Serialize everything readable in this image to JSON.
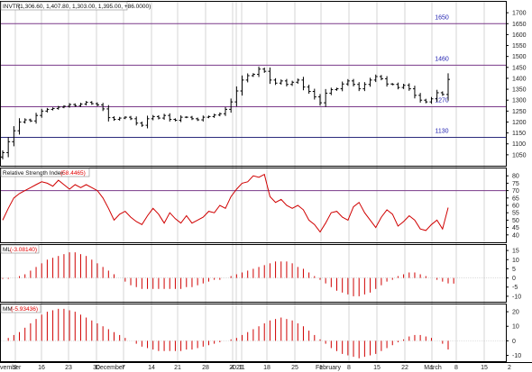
{
  "chart_data": [
    {
      "type": "ohlc",
      "panel": "price",
      "symbol": "INVTR",
      "header_values": "(1,306.60, 1,407.80, 1,303.00, 1,395.00, +86.0000)",
      "ylim": [
        1000,
        1750
      ],
      "yticks": [
        "1700",
        "1650",
        "1600",
        "1550",
        "1500",
        "1450",
        "1400",
        "1350",
        "1300",
        "1250",
        "1200",
        "1150",
        "1100",
        "1050"
      ],
      "ytick_values": [
        1700,
        1650,
        1600,
        1550,
        1500,
        1450,
        1400,
        1350,
        1300,
        1250,
        1200,
        1150,
        1100,
        1050
      ],
      "levels": [
        {
          "value": 1650,
          "label": "1650"
        },
        {
          "value": 1460,
          "label": "1460"
        },
        {
          "value": 1270,
          "label": "1270"
        },
        {
          "value": 1130,
          "label": "1130"
        }
      ],
      "close": [
        1060,
        1110,
        1160,
        1200,
        1210,
        1205,
        1230,
        1250,
        1258,
        1262,
        1268,
        1272,
        1280,
        1275,
        1282,
        1290,
        1284,
        1278,
        1260,
        1220,
        1212,
        1218,
        1222,
        1215,
        1195,
        1185,
        1215,
        1225,
        1218,
        1230,
        1212,
        1208,
        1222,
        1222,
        1215,
        1210,
        1222,
        1225,
        1232,
        1238,
        1258,
        1292,
        1342,
        1392,
        1412,
        1418,
        1442,
        1432,
        1392,
        1378,
        1388,
        1372,
        1382,
        1392,
        1360,
        1340,
        1315,
        1288,
        1332,
        1348,
        1352,
        1374,
        1388,
        1372,
        1352,
        1372,
        1392,
        1408,
        1398,
        1374,
        1372,
        1358,
        1368,
        1352,
        1322,
        1300,
        1292,
        1306,
        1334,
        1326,
        1395
      ]
    },
    {
      "type": "line",
      "panel": "rsi",
      "title": "Relative Strength Index",
      "value_label": "(58.4465)",
      "ylim": [
        35,
        85
      ],
      "yticks": [
        "80",
        "75",
        "70",
        "65",
        "60",
        "55",
        "50",
        "45",
        "40"
      ],
      "ytick_values": [
        80,
        75,
        70,
        65,
        60,
        55,
        50,
        45,
        40
      ],
      "hline": 70,
      "values": [
        50,
        58,
        65,
        68,
        70,
        72,
        74,
        76,
        75,
        73,
        77,
        74,
        71,
        74,
        72,
        74,
        72,
        70,
        65,
        58,
        50,
        54,
        56,
        52,
        49,
        47,
        53,
        58,
        54,
        48,
        55,
        51,
        48,
        53,
        48,
        50,
        52,
        56,
        55,
        60,
        58,
        66,
        71,
        75,
        76,
        80,
        79,
        81,
        66,
        62,
        64,
        60,
        58,
        60,
        57,
        50,
        47,
        42,
        48,
        55,
        56,
        52,
        50,
        59,
        62,
        55,
        50,
        45,
        52,
        57,
        54,
        46,
        49,
        53,
        50,
        44,
        43,
        47,
        50,
        44,
        58.4465
      ]
    },
    {
      "type": "histogram",
      "panel": "ml",
      "title": "ML",
      "value_label": "(-3.08140)",
      "ylim": [
        -13,
        18
      ],
      "yticks": [
        "15",
        "10",
        "5",
        "0",
        "-5",
        "-10"
      ],
      "ytick_values": [
        15,
        10,
        5,
        0,
        -5,
        -10
      ],
      "values": [
        -0.5,
        -0.5,
        0,
        1,
        2,
        4,
        6,
        8,
        10,
        11,
        12,
        13,
        14,
        14,
        13,
        12,
        10,
        8,
        6,
        4,
        2,
        0,
        -2,
        -4,
        -5,
        -6,
        -6,
        -6,
        -6,
        -6,
        -6,
        -6,
        -6,
        -5,
        -5,
        -4,
        -3,
        -2,
        -1,
        -1,
        0,
        1,
        2,
        3,
        4,
        5,
        6,
        7,
        8,
        9,
        9,
        9,
        8,
        6,
        5,
        3,
        1,
        -1,
        -3,
        -5,
        -7,
        -8,
        -9,
        -10,
        -10,
        -9,
        -8,
        -6,
        -4,
        -2,
        -1,
        1,
        2,
        3,
        3,
        2,
        1,
        0,
        -1,
        -2,
        -3,
        -3.0814
      ]
    },
    {
      "type": "histogram",
      "panel": "mm",
      "title": "MM",
      "value_label": "(-5.93436)",
      "ylim": [
        -14,
        25
      ],
      "yticks": [
        "20",
        "10",
        "0",
        "-10"
      ],
      "ytick_values": [
        20,
        10,
        0,
        -10
      ],
      "values": [
        0,
        2,
        4,
        6,
        9,
        12,
        15,
        18,
        20,
        21,
        22,
        22,
        21,
        20,
        18,
        16,
        14,
        12,
        10,
        8,
        6,
        4,
        2,
        0,
        -2,
        -4,
        -5,
        -6,
        -7,
        -7,
        -7,
        -7,
        -7,
        -6,
        -6,
        -5,
        -4,
        -3,
        -2,
        -1,
        0,
        1,
        2,
        4,
        6,
        8,
        10,
        12,
        14,
        15,
        16,
        15,
        14,
        12,
        10,
        7,
        4,
        1,
        -2,
        -5,
        -7,
        -9,
        -10,
        -11,
        -12,
        -11,
        -10,
        -9,
        -7,
        -5,
        -3,
        -1,
        1,
        3,
        4,
        4,
        3,
        2,
        0,
        -2,
        -5.93436
      ]
    }
  ],
  "x_axis": {
    "labels": [
      "vember",
      "9",
      "16",
      "23",
      "30",
      "December",
      "7",
      "14",
      "21",
      "28",
      "4",
      "2021",
      "11",
      "18",
      "25",
      "1",
      "February",
      "8",
      "15",
      "22",
      "1",
      "March",
      "8",
      "15",
      "2"
    ]
  }
}
